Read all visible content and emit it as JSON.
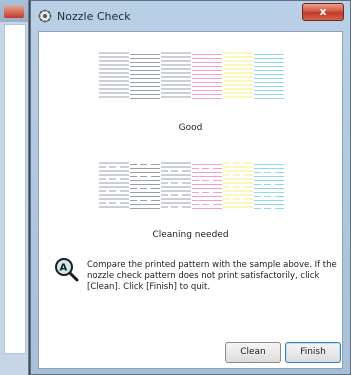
{
  "window": {
    "title": "Nozzle Check",
    "close_glyph": "x"
  },
  "patterns": {
    "good_label": "Good",
    "bad_label": "Cleaning needed",
    "colors": [
      "#9aa0a8",
      "#9aa0a8",
      "#9aa0a8",
      "#f5a0c8",
      "#f4f07a",
      "#8fd8ee"
    ]
  },
  "message": "Compare the printed pattern with the sample above. If the nozzle check pattern does not print satisfactorily, click [Clean]. Click [Finish] to quit.",
  "buttons": {
    "clean": "Clean",
    "finish": "Finish"
  },
  "icons": {
    "title": "printer-gear-icon",
    "help": "help-magnifier-icon"
  }
}
